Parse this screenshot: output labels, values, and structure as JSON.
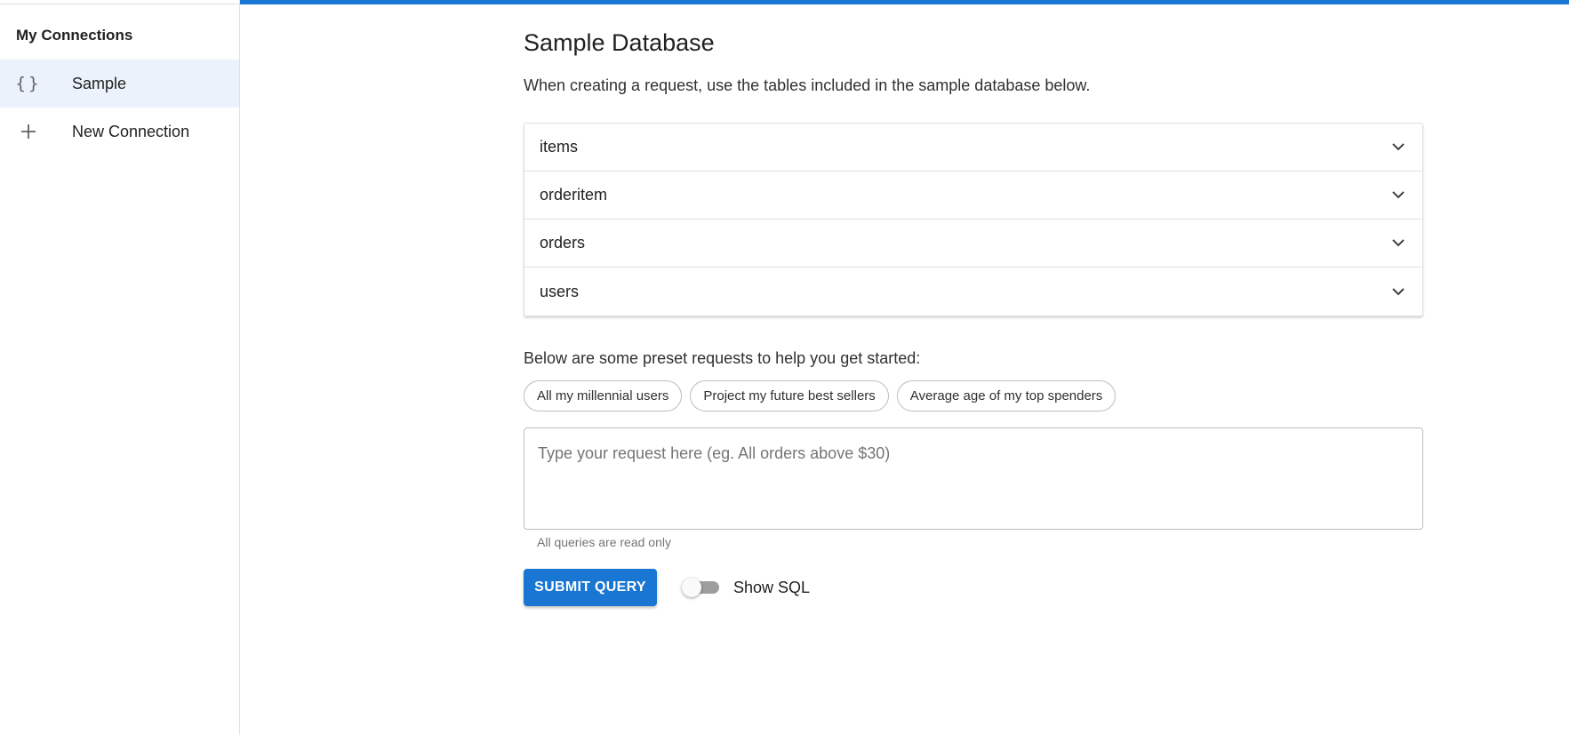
{
  "sidebar": {
    "title": "My Connections",
    "items": [
      {
        "label": "Sample",
        "icon": "braces-icon",
        "glyph": "{}",
        "active": true
      },
      {
        "label": "New Connection",
        "icon": "plus-icon",
        "active": false
      }
    ]
  },
  "header": {
    "accent_color": "#1976d2"
  },
  "main": {
    "title": "Sample Database",
    "intro": "When creating a request, use the tables included in the sample database below.",
    "tables": [
      {
        "label": "items"
      },
      {
        "label": "orderitem"
      },
      {
        "label": "orders"
      },
      {
        "label": "users"
      }
    ],
    "presets_heading": "Below are some preset requests to help you get started:",
    "presets": [
      "All my millennial users",
      "Project my future best sellers",
      "Average age of my top spenders"
    ],
    "request": {
      "value": "",
      "placeholder": "Type your request here (eg. All orders above $30)"
    },
    "hint": "All queries are read only",
    "submit_label": "SUBMIT QUERY",
    "show_sql": {
      "label": "Show SQL",
      "checked": false
    }
  }
}
